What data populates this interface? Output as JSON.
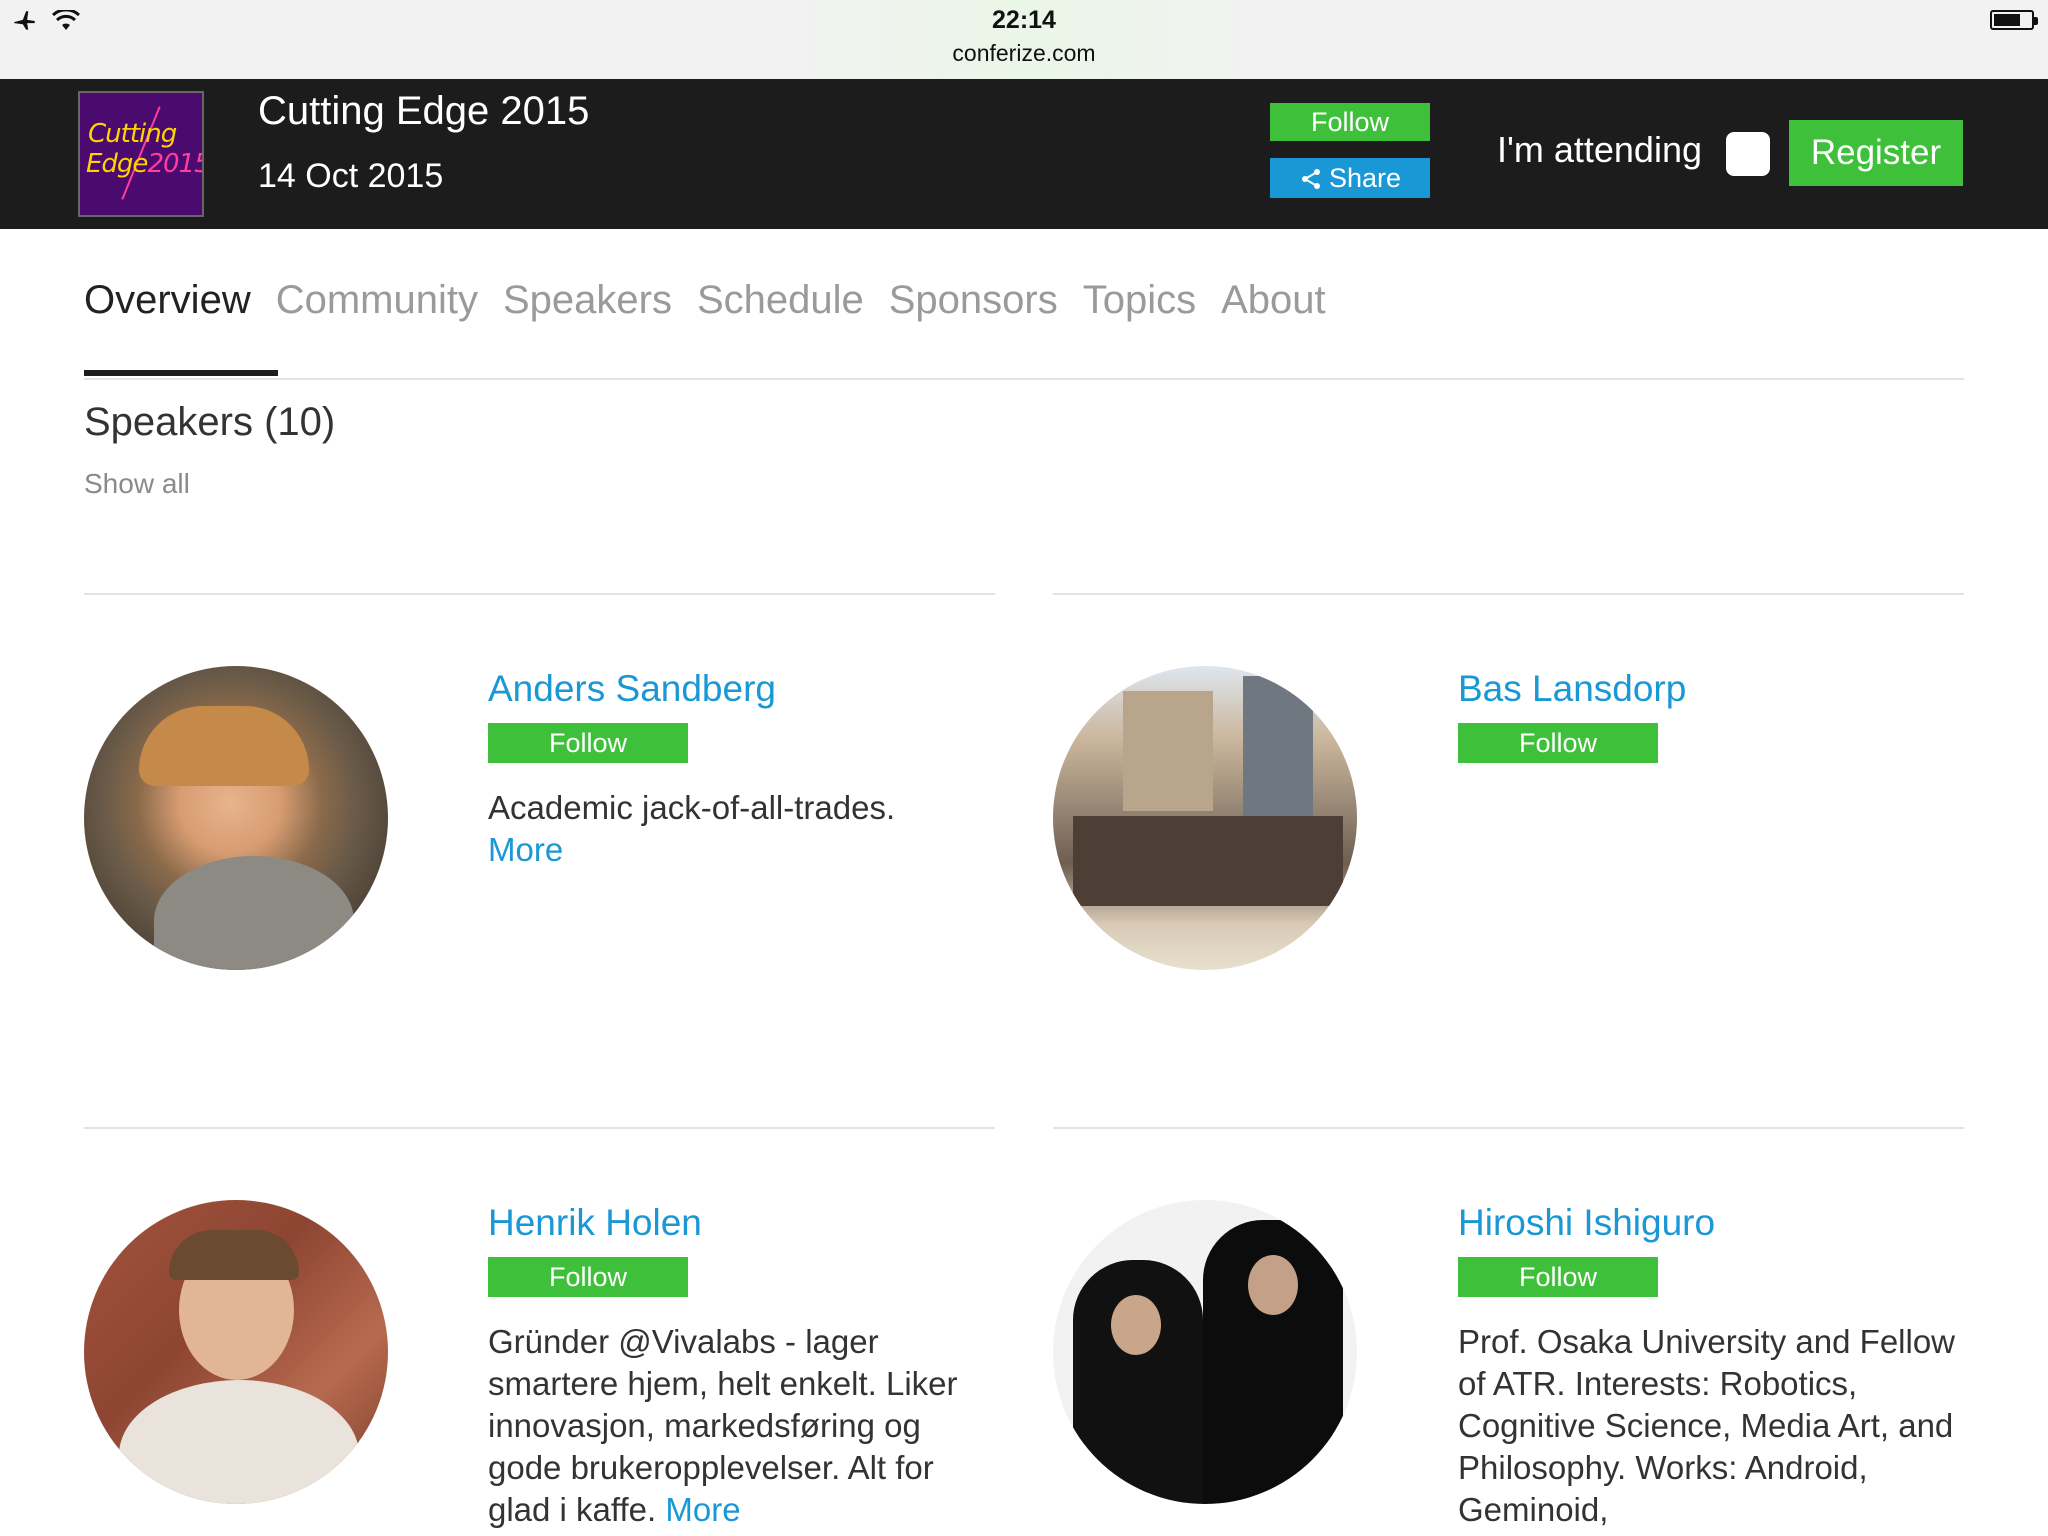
{
  "status_bar": {
    "time": "22:14",
    "url": "conferize.com"
  },
  "event": {
    "logo_line1": "Cutting",
    "logo_line2a": "Edge",
    "logo_line2b": "2015",
    "title": "Cutting Edge 2015",
    "date": "14 Oct 2015",
    "follow_label": "Follow",
    "share_label": "Share",
    "attending_label": "I'm attending",
    "attending_checked": false,
    "register_label": "Register"
  },
  "tabs": [
    {
      "label": "Overview",
      "active": true
    },
    {
      "label": "Community",
      "active": false
    },
    {
      "label": "Speakers",
      "active": false
    },
    {
      "label": "Schedule",
      "active": false
    },
    {
      "label": "Sponsors",
      "active": false
    },
    {
      "label": "Topics",
      "active": false
    },
    {
      "label": "About",
      "active": false
    }
  ],
  "speakers_section": {
    "title": "Speakers (10)",
    "show_all": "Show all"
  },
  "speakers": [
    {
      "name": "Anders Sandberg",
      "follow": "Follow",
      "bio": "Academic jack-of-all-trades.",
      "more": "More"
    },
    {
      "name": "Bas Lansdorp",
      "follow": "Follow",
      "bio": "",
      "more": ""
    },
    {
      "name": "Henrik Holen",
      "follow": "Follow",
      "bio": "Gründer @Vivalabs - lager smartere hjem, helt enkelt. Liker innovasjon, markedsføring og gode brukeropplevelser. Alt for glad i kaffe.",
      "more": "More"
    },
    {
      "name": "Hiroshi Ishiguro",
      "follow": "Follow",
      "bio": "Prof. Osaka University and Fellow of ATR. Interests: Robotics, Cognitive Science, Media Art, and Philosophy. Works: Android, Geminoid,",
      "more": ""
    }
  ],
  "colors": {
    "header_bg": "#1c1c1c",
    "green": "#3ec03a",
    "blue": "#1a98d5"
  }
}
